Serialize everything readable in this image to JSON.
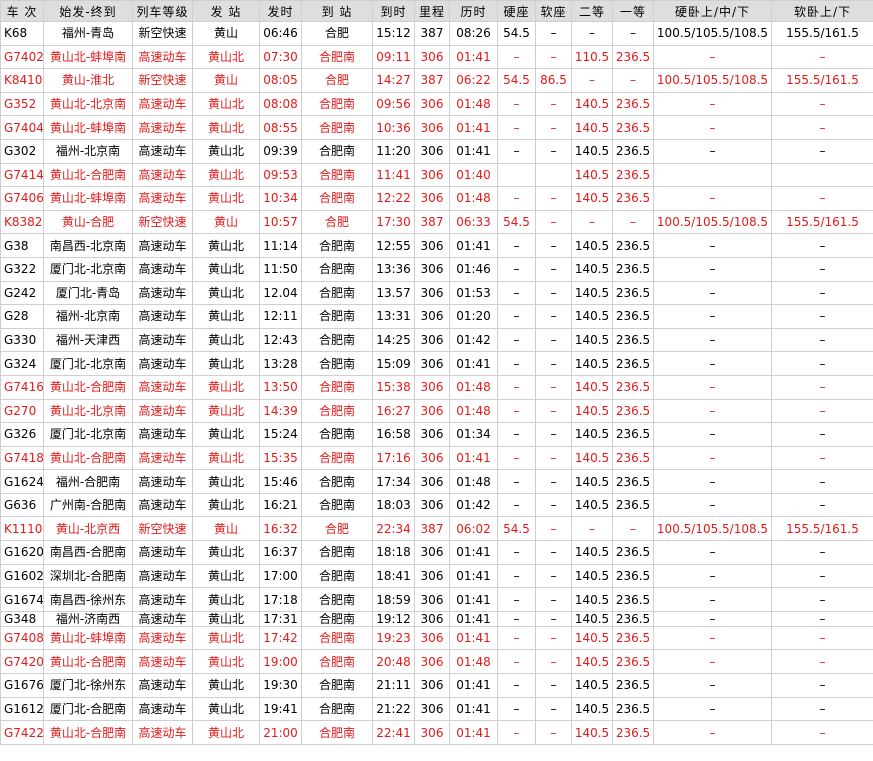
{
  "columns": [
    "车 次",
    "始发-终到",
    "列车等级",
    "发  站",
    "发时",
    "到  站",
    "到时",
    "里程",
    "历时",
    "硬座",
    "软座",
    "二等",
    "一等",
    "硬卧上/中/下",
    "软卧上/下"
  ],
  "rows": [
    {
      "v": [
        "K68",
        "福州-青岛",
        "新空快速",
        "黄山",
        "06:46",
        "合肥",
        "15:12",
        "387",
        "08:26",
        "54.5",
        "–",
        "–",
        "–",
        "100.5/105.5/108.5",
        "155.5/161.5"
      ],
      "red": false
    },
    {
      "v": [
        "G7402",
        "黄山北-蚌埠南",
        "高速动车",
        "黄山北",
        "07:30",
        "合肥南",
        "09:11",
        "306",
        "01:41",
        "–",
        "–",
        "110.5",
        "236.5",
        "–",
        "–"
      ],
      "red": true
    },
    {
      "v": [
        "K8410",
        "黄山-淮北",
        "新空快速",
        "黄山",
        "08:05",
        "合肥",
        "14:27",
        "387",
        "06:22",
        "54.5",
        "86.5",
        "–",
        "–",
        "100.5/105.5/108.5",
        "155.5/161.5"
      ],
      "red": true
    },
    {
      "v": [
        "G352",
        "黄山北-北京南",
        "高速动车",
        "黄山北",
        "08:08",
        "合肥南",
        "09:56",
        "306",
        "01:48",
        "–",
        "–",
        "140.5",
        "236.5",
        "–",
        "–"
      ],
      "red": true
    },
    {
      "v": [
        "G7404",
        "黄山北-蚌埠南",
        "高速动车",
        "黄山北",
        "08:55",
        "合肥南",
        "10:36",
        "306",
        "01:41",
        "–",
        "–",
        "140.5",
        "236.5",
        "–",
        "–"
      ],
      "red": true
    },
    {
      "v": [
        "G302",
        "福州-北京南",
        "高速动车",
        "黄山北",
        "09:39",
        "合肥南",
        "11:20",
        "306",
        "01:41",
        "–",
        "–",
        "140.5",
        "236.5",
        "–",
        "–"
      ],
      "red": false
    },
    {
      "v": [
        "G7414",
        "黄山北-合肥南",
        "高速动车",
        "黄山北",
        "09:53",
        "合肥南",
        "11:41",
        "306",
        "01:40",
        "",
        "",
        "140.5",
        "236.5",
        "",
        ""
      ],
      "red": true
    },
    {
      "v": [
        "G7406",
        "黄山北-蚌埠南",
        "高速动车",
        "黄山北",
        "10:34",
        "合肥南",
        "12:22",
        "306",
        "01:48",
        "–",
        "–",
        "140.5",
        "236.5",
        "–",
        "–"
      ],
      "red": true
    },
    {
      "v": [
        "K8382",
        "黄山-合肥",
        "新空快速",
        "黄山",
        "10:57",
        "合肥",
        "17:30",
        "387",
        "06:33",
        "54.5",
        "–",
        "–",
        "–",
        "100.5/105.5/108.5",
        "155.5/161.5"
      ],
      "red": true
    },
    {
      "v": [
        "G38",
        "南昌西-北京南",
        "高速动车",
        "黄山北",
        "11:14",
        "合肥南",
        "12:55",
        "306",
        "01:41",
        "–",
        "–",
        "140.5",
        "236.5",
        "–",
        "–"
      ],
      "red": false
    },
    {
      "v": [
        "G322",
        "厦门北-北京南",
        "高速动车",
        "黄山北",
        "11:50",
        "合肥南",
        "13:36",
        "306",
        "01:46",
        "–",
        "–",
        "140.5",
        "236.5",
        "–",
        "–"
      ],
      "red": false
    },
    {
      "v": [
        "G242",
        "厦门北-青岛",
        "高速动车",
        "黄山北",
        "12.04",
        "合肥南",
        "13.57",
        "306",
        "01:53",
        "–",
        "–",
        "140.5",
        "236.5",
        "–",
        "–"
      ],
      "red": false
    },
    {
      "v": [
        "G28",
        "福州-北京南",
        "高速动车",
        "黄山北",
        "12:11",
        "合肥南",
        "13:31",
        "306",
        "01:20",
        "–",
        "–",
        "140.5",
        "236.5",
        "–",
        "–"
      ],
      "red": false
    },
    {
      "v": [
        "G330",
        "福州-天津西",
        "高速动车",
        "黄山北",
        "12:43",
        "合肥南",
        "14:25",
        "306",
        "01:42",
        "–",
        "–",
        "140.5",
        "236.5",
        "–",
        "–"
      ],
      "red": false
    },
    {
      "v": [
        "G324",
        "厦门北-北京南",
        "高速动车",
        "黄山北",
        "13:28",
        "合肥南",
        "15:09",
        "306",
        "01:41",
        "–",
        "–",
        "140.5",
        "236.5",
        "–",
        "–"
      ],
      "red": false
    },
    {
      "v": [
        "G7416",
        "黄山北-合肥南",
        "高速动车",
        "黄山北",
        "13:50",
        "合肥南",
        "15:38",
        "306",
        "01:48",
        "–",
        "–",
        "140.5",
        "236.5",
        "–",
        "–"
      ],
      "red": true
    },
    {
      "v": [
        "G270",
        "黄山北-北京南",
        "高速动车",
        "黄山北",
        "14:39",
        "合肥南",
        "16:27",
        "306",
        "01:48",
        "–",
        "–",
        "140.5",
        "236.5",
        "–",
        "–"
      ],
      "red": true
    },
    {
      "v": [
        "G326",
        "厦门北-北京南",
        "高速动车",
        "黄山北",
        "15:24",
        "合肥南",
        "16:58",
        "306",
        "01:34",
        "–",
        "–",
        "140.5",
        "236.5",
        "–",
        "–"
      ],
      "red": false
    },
    {
      "v": [
        "G7418",
        "黄山北-合肥南",
        "高速动车",
        "黄山北",
        "15:35",
        "合肥南",
        "17:16",
        "306",
        "01:41",
        "–",
        "–",
        "140.5",
        "236.5",
        "–",
        "–"
      ],
      "red": true
    },
    {
      "v": [
        "G1624",
        "福州-合肥南",
        "高速动车",
        "黄山北",
        "15:46",
        "合肥南",
        "17:34",
        "306",
        "01:48",
        "–",
        "–",
        "140.5",
        "236.5",
        "–",
        "–"
      ],
      "red": false
    },
    {
      "v": [
        "G636",
        "广州南-合肥南",
        "高速动车",
        "黄山北",
        "16:21",
        "合肥南",
        "18:03",
        "306",
        "01:42",
        "–",
        "–",
        "140.5",
        "236.5",
        "–",
        "–"
      ],
      "red": false
    },
    {
      "v": [
        "K1110",
        "黄山-北京西",
        "新空快速",
        "黄山",
        "16:32",
        "合肥",
        "22:34",
        "387",
        "06:02",
        "54.5",
        "–",
        "–",
        "–",
        "100.5/105.5/108.5",
        "155.5/161.5"
      ],
      "red": true
    },
    {
      "v": [
        "G1620",
        "南昌西-合肥南",
        "高速动车",
        "黄山北",
        "16:37",
        "合肥南",
        "18:18",
        "306",
        "01:41",
        "–",
        "–",
        "140.5",
        "236.5",
        "–",
        "–"
      ],
      "red": false
    },
    {
      "v": [
        "G1602",
        "深圳北-合肥南",
        "高速动车",
        "黄山北",
        "17:00",
        "合肥南",
        "18:41",
        "306",
        "01:41",
        "–",
        "–",
        "140.5",
        "236.5",
        "–",
        "–"
      ],
      "red": false
    },
    {
      "v": [
        "G1674",
        "南昌西-徐州东",
        "高速动车",
        "黄山北",
        "17:18",
        "合肥南",
        "18:59",
        "306",
        "01:41",
        "–",
        "–",
        "140.5",
        "236.5",
        "–",
        "–"
      ],
      "red": false
    },
    {
      "v": [
        "G348",
        "福州-济南西",
        "高速动车",
        "黄山北",
        "17:31",
        "合肥南",
        "19:12",
        "306",
        "01:41",
        "–",
        "–",
        "140.5",
        "236.5",
        "–",
        "–"
      ],
      "red": false
    },
    {
      "v": [
        "G7408",
        "黄山北-蚌埠南",
        "高速动车",
        "黄山北",
        "17:42",
        "合肥南",
        "19:23",
        "306",
        "01:41",
        "–",
        "–",
        "140.5",
        "236.5",
        "–",
        "–"
      ],
      "red": true
    },
    {
      "v": [
        "G7420",
        "黄山北-合肥南",
        "高速动车",
        "黄山北",
        "19:00",
        "合肥南",
        "20:48",
        "306",
        "01:48",
        "–",
        "–",
        "140.5",
        "236.5",
        "–",
        "–"
      ],
      "red": true
    },
    {
      "v": [
        "G1676",
        "厦门北-徐州东",
        "高速动车",
        "黄山北",
        "19:30",
        "合肥南",
        "21:11",
        "306",
        "01:41",
        "–",
        "–",
        "140.5",
        "236.5",
        "–",
        "–"
      ],
      "red": false
    },
    {
      "v": [
        "G1612",
        "厦门北-合肥南",
        "高速动车",
        "黄山北",
        "19:41",
        "合肥南",
        "21:22",
        "306",
        "01:41",
        "–",
        "–",
        "140.5",
        "236.5",
        "–",
        "–"
      ],
      "red": false
    },
    {
      "v": [
        "G7422",
        "黄山北-合肥南",
        "高速动车",
        "黄山北",
        "21:00",
        "合肥南",
        "22:41",
        "306",
        "01:41",
        "–",
        "–",
        "140.5",
        "236.5",
        "–",
        "–"
      ],
      "red": true
    }
  ]
}
